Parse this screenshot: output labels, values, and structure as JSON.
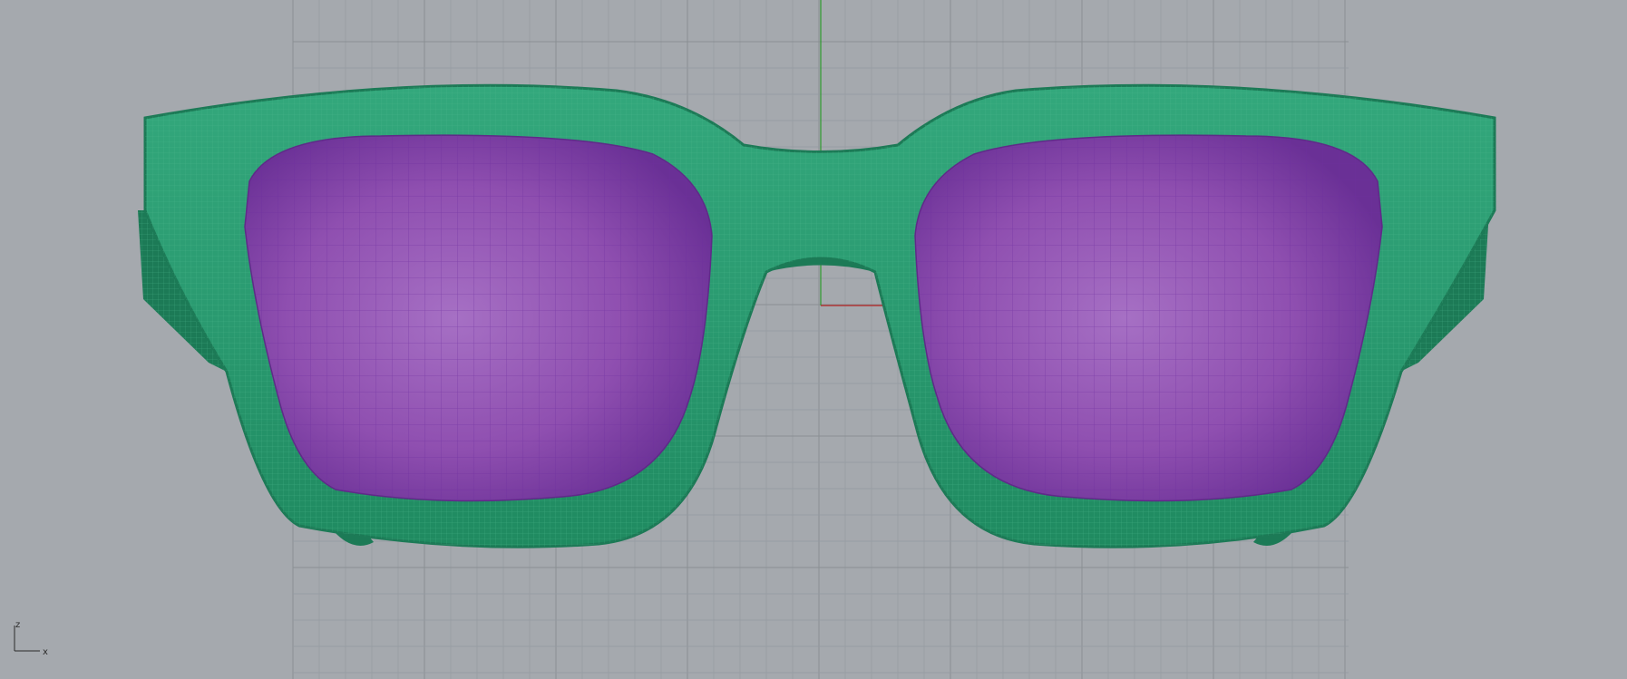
{
  "viewport": {
    "background_color": "#a5a9ae",
    "grid_minor_color": "#959aa0",
    "grid_major_color": "#8a8f94",
    "axis_vertical_color": "#2e9a2e",
    "axis_horizontal_color": "#b52222"
  },
  "model": {
    "frame_color": "#2a9a70",
    "frame_dark_color": "#1c7a56",
    "frame_mesh_color": "#4fb88f",
    "lens_color": "#8f4fb0",
    "lens_light_color": "#a670c4",
    "lens_dark_color": "#6a3096",
    "lens_mesh_color": "#6e2ea0"
  },
  "axis_gizmo": {
    "vertical_label": "z",
    "horizontal_label": "x"
  }
}
